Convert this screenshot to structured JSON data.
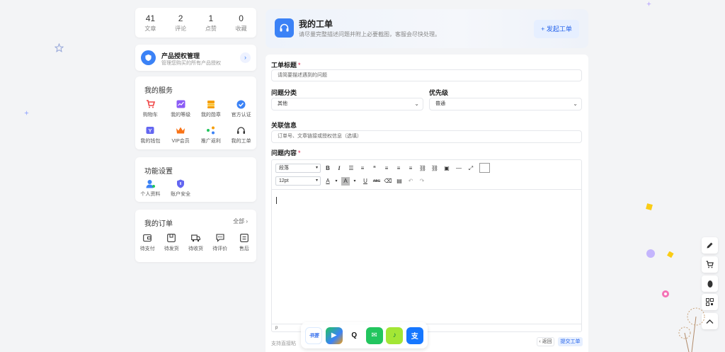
{
  "stats": [
    {
      "value": "41",
      "label": "文章"
    },
    {
      "value": "2",
      "label": "评论"
    },
    {
      "value": "1",
      "label": "点赞"
    },
    {
      "value": "0",
      "label": "收藏"
    }
  ],
  "product": {
    "title": "产品授权管理",
    "subtitle": "管理您购买的所有产品授权",
    "arrow": "›"
  },
  "services": {
    "title": "我的服务",
    "items": [
      {
        "label": "购物车",
        "icon": "cart-icon"
      },
      {
        "label": "我的等级",
        "icon": "chart-icon"
      },
      {
        "label": "我的勋章",
        "icon": "medal-icon"
      },
      {
        "label": "官方认证",
        "icon": "verified-icon"
      },
      {
        "label": "我的钱包",
        "icon": "wallet-icon"
      },
      {
        "label": "VIP会员",
        "icon": "crown-icon"
      },
      {
        "label": "推广返利",
        "icon": "share-icon"
      },
      {
        "label": "我的工单",
        "icon": "headset-icon"
      }
    ]
  },
  "functions": {
    "title": "功能设置",
    "items": [
      {
        "label": "个人资料",
        "icon": "user-icon"
      },
      {
        "label": "账户安全",
        "icon": "shield-icon"
      }
    ]
  },
  "orders": {
    "title": "我的订单",
    "all": "全部 ›",
    "items": [
      {
        "label": "待支付",
        "icon": "wallet-icon"
      },
      {
        "label": "待发货",
        "icon": "box-icon"
      },
      {
        "label": "待收货",
        "icon": "truck-icon"
      },
      {
        "label": "待评价",
        "icon": "chat-icon"
      },
      {
        "label": "售后",
        "icon": "refund-icon"
      }
    ]
  },
  "header": {
    "title": "我的工单",
    "subtitle": "请尽量完整描述问题并附上必要截图，客服会尽快处理。",
    "button": "+ 发起工单"
  },
  "form": {
    "title_label": "工单标题",
    "title_placeholder": "请简要描述遇到的问题",
    "category_label": "问题分类",
    "category_value": "其他",
    "priority_label": "优先级",
    "priority_value": "普通",
    "related_label": "关联信息",
    "related_placeholder": "订单号、文章链接或授权信息（选填）",
    "content_label": "问题内容",
    "editor": {
      "block_format": "段落",
      "font_size": "12pt",
      "status": "p"
    },
    "footer_hint": "支持直接粘",
    "back": "‹ 返回",
    "submit": "提交工单"
  },
  "dock": [
    {
      "name": "tiebajun-icon",
      "text": "书签"
    },
    {
      "name": "play-icon",
      "text": "▶"
    },
    {
      "name": "qq-icon",
      "text": "Q"
    },
    {
      "name": "wechat-icon",
      "text": "✉"
    },
    {
      "name": "music-icon",
      "text": "♪"
    },
    {
      "name": "alipay-icon",
      "text": "支"
    }
  ],
  "colors": {
    "accent": "#3b82f6",
    "required": "#e11d48",
    "background": "#f3f4f6"
  }
}
